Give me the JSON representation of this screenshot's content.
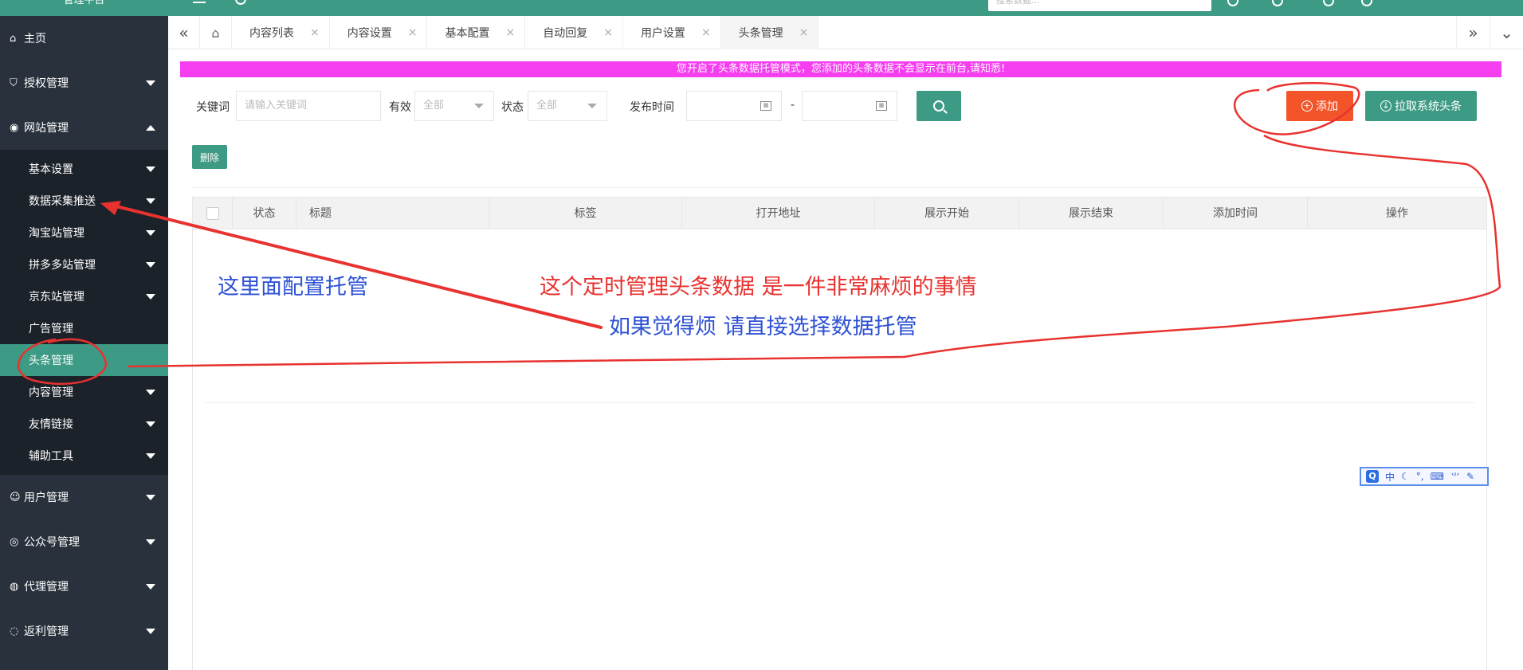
{
  "header": {
    "title": "管理平台",
    "search_placeholder": "搜索数据..."
  },
  "sidebar": {
    "items": [
      {
        "label": "主页",
        "icon": "home-icon"
      },
      {
        "label": "授权管理",
        "icon": "shield-check-icon"
      },
      {
        "label": "网站管理",
        "icon": "globe-icon"
      }
    ],
    "website_sub": [
      {
        "label": "基本设置"
      },
      {
        "label": "数据采集推送"
      },
      {
        "label": "淘宝站管理"
      },
      {
        "label": "拼多多站管理"
      },
      {
        "label": "京东站管理"
      },
      {
        "label": "广告管理"
      },
      {
        "label": "头条管理"
      },
      {
        "label": "内容管理"
      },
      {
        "label": "友情链接"
      },
      {
        "label": "辅助工具"
      }
    ],
    "bottom_items": [
      {
        "label": "用户管理",
        "icon": "user-icon"
      },
      {
        "label": "公众号管理",
        "icon": "wechat-icon"
      },
      {
        "label": "代理管理",
        "icon": "agent-icon"
      },
      {
        "label": "返利管理",
        "icon": "rebate-icon"
      }
    ]
  },
  "tabs": [
    {
      "label": "内容列表"
    },
    {
      "label": "内容设置"
    },
    {
      "label": "基本配置"
    },
    {
      "label": "自动回复"
    },
    {
      "label": "用户设置"
    },
    {
      "label": "头条管理"
    }
  ],
  "tab_close": "×",
  "notice": "您开启了头条数据托管模式，您添加的头条数据不会显示在前台,请知悉!",
  "filters": {
    "keyword_label": "关键词",
    "keyword_placeholder": "请输入关键词",
    "valid_label": "有效",
    "valid_value": "全部",
    "status_label": "状态",
    "status_value": "全部",
    "publish_label": "发布时间",
    "date_sep": "-"
  },
  "buttons": {
    "add": "添加",
    "pull": "拉取系统头条",
    "delete": "删除"
  },
  "table": {
    "columns": [
      "状态",
      "标题",
      "标签",
      "打开地址",
      "展示开始",
      "展示结束",
      "添加时间",
      "操作"
    ]
  },
  "annotations": {
    "left": "这里面配置托管",
    "main": "这个定时管理头条数据 是一件非常麻烦的事情",
    "sub": "如果觉得烦 请直接选择数据托管"
  },
  "ime": {
    "logo": "Q",
    "lang": "中"
  }
}
